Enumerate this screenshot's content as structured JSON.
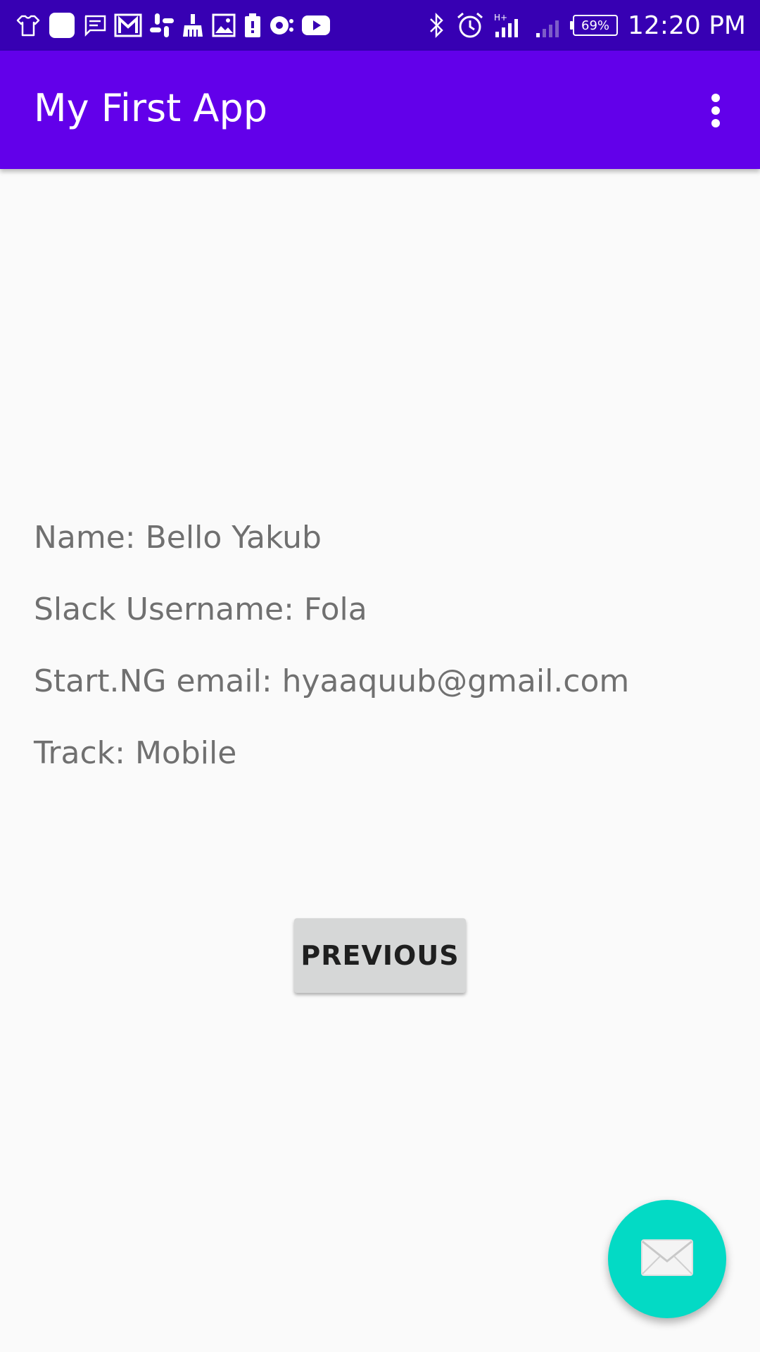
{
  "status_bar": {
    "time": "12:20 PM",
    "battery": "69%",
    "left_icons": [
      "shirt-icon",
      "square-app-icon",
      "message-icon",
      "gmail-icon",
      "slack-icon",
      "broom-icon",
      "image-icon",
      "battery-alert-icon",
      "lens-icon",
      "youtube-icon"
    ],
    "right_icons": [
      "bluetooth-icon",
      "alarm-icon",
      "signal-icon",
      "signal-weak-icon"
    ]
  },
  "app_bar": {
    "title": "My First App",
    "menu_icon": "more-vert-icon",
    "color": "#6200ea"
  },
  "profile": {
    "name": "Name: Bello Yakub",
    "slack": "Slack Username: Fola",
    "email": "Start.NG email: hyaaquub@gmail.com",
    "track": "Track: Mobile"
  },
  "buttons": {
    "previous_label": "PREVIOUS"
  },
  "fab": {
    "icon": "email-icon",
    "color": "#03dac5"
  }
}
